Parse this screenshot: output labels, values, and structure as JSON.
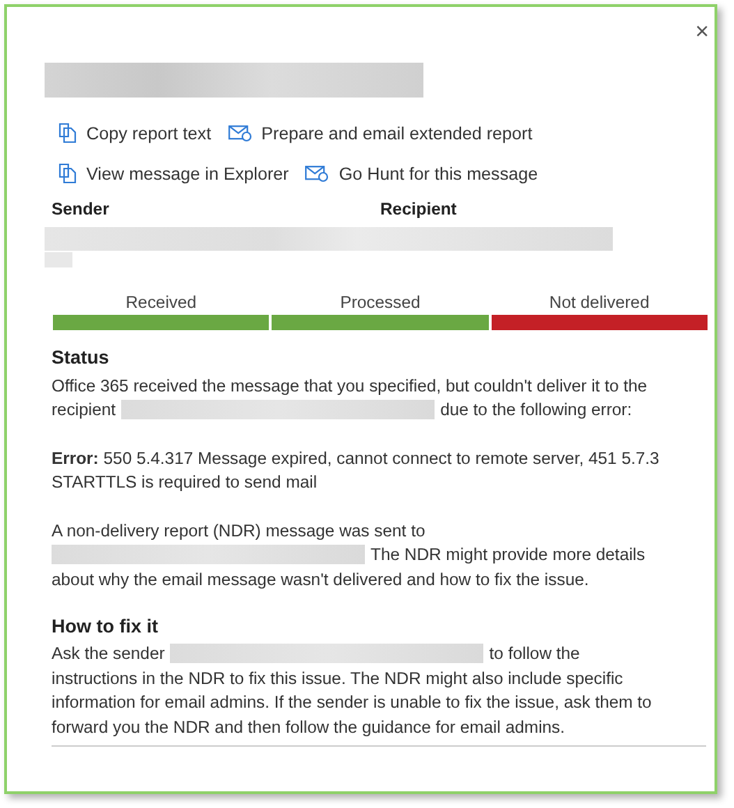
{
  "close": "×",
  "title_redacted": true,
  "actions": [
    [
      {
        "label": "Copy report text",
        "kind": "copy"
      },
      {
        "label": "Prepare and email extended report",
        "kind": "mail"
      }
    ],
    [
      {
        "label": "View message in Explorer",
        "kind": "copy"
      },
      {
        "label": "Go Hunt for this message",
        "kind": "mail"
      }
    ]
  ],
  "columns": [
    "Sender",
    "Recipient"
  ],
  "addresses_redacted": true,
  "stages": [
    {
      "label": "Received",
      "color": "#6aa843"
    },
    {
      "label": "Processed",
      "color": "#6aa843"
    },
    {
      "label": "Not delivered",
      "color": "#c42026"
    }
  ],
  "sections": [
    {
      "heading": "Status",
      "paragraphs": [
        [
          [
            {
              "kind": "text",
              "text": "Office 365 received the message that you specified, but couldn't deliver it to the"
            }
          ],
          [
            {
              "kind": "text",
              "text": "recipient"
            },
            {
              "kind": "redacted"
            },
            {
              "kind": "text",
              "text": "due to the following error:"
            }
          ]
        ],
        [
          [
            {
              "kind": "text",
              "text": "**Error:** 550 5.4.317 Message expired, cannot connect to remote server, 451 5.7.3"
            }
          ],
          [
            {
              "kind": "text",
              "text": "STARTTLS is required to send mail"
            }
          ]
        ],
        [
          [
            {
              "kind": "text",
              "text": "A non-delivery report (NDR) message was sent to"
            }
          ],
          [
            {
              "kind": "redacted"
            },
            {
              "kind": "text",
              "text": "The NDR might provide more details"
            }
          ],
          [
            {
              "kind": "text",
              "text": "about why the email message wasn't delivered and how to fix the issue."
            }
          ]
        ]
      ]
    },
    {
      "heading": "How to fix it",
      "paragraphs": [
        [
          [
            {
              "kind": "text",
              "text": "Ask the sender"
            },
            {
              "kind": "redacted"
            },
            {
              "kind": "text",
              "text": "to follow the"
            }
          ],
          [
            {
              "kind": "text",
              "text": "instructions in the NDR to fix this issue. The NDR might also include specific"
            }
          ],
          [
            {
              "kind": "text",
              "text": "information for email admins. If the sender is unable to fix the issue, ask them to"
            }
          ],
          [
            {
              "kind": "text",
              "text": "forward you the NDR and then follow the guidance for email admins."
            }
          ]
        ]
      ]
    }
  ]
}
